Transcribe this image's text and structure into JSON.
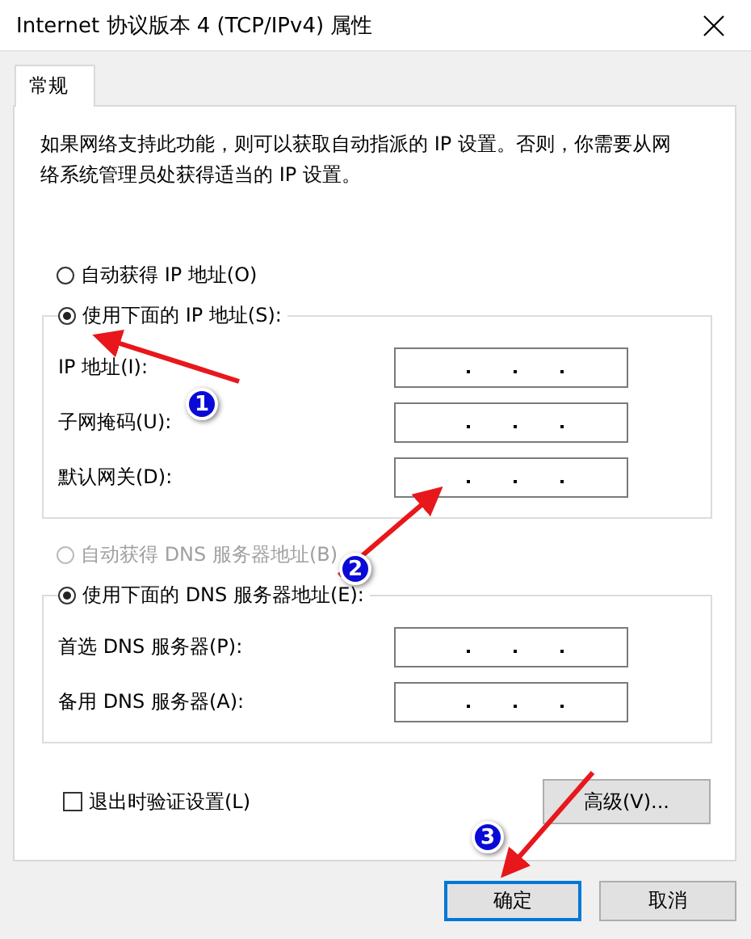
{
  "window": {
    "title": "Internet 协议版本 4 (TCP/IPv4) 属性"
  },
  "tabs": [
    {
      "label": "常规",
      "selected": true
    }
  ],
  "description": "如果网络支持此功能，则可以获取自动指派的 IP 设置。否则，你需要从网络系统管理员处获得适当的 IP 设置。",
  "ip_section": {
    "auto_option": {
      "label": "自动获得 IP 地址(O)",
      "selected": false,
      "disabled": false
    },
    "manual_option": {
      "label": "使用下面的 IP 地址(S):",
      "selected": true,
      "disabled": false
    },
    "fields": [
      {
        "label": "IP 地址(I):"
      },
      {
        "label": "子网掩码(U):"
      },
      {
        "label": "默认网关(D):"
      }
    ]
  },
  "dns_section": {
    "auto_option": {
      "label": "自动获得 DNS 服务器地址(B)",
      "selected": false,
      "disabled": true
    },
    "manual_option": {
      "label": "使用下面的 DNS 服务器地址(E):",
      "selected": true,
      "disabled": false
    },
    "fields": [
      {
        "label": "首选 DNS 服务器(P):"
      },
      {
        "label": "备用 DNS 服务器(A):"
      }
    ]
  },
  "validate_checkbox": {
    "label": "退出时验证设置(L)",
    "checked": false
  },
  "advanced_button": "高级(V)...",
  "buttons": [
    {
      "label": "确定",
      "focused": true
    },
    {
      "label": "取消",
      "focused": false
    }
  ],
  "annotations": [
    {
      "label": "1"
    },
    {
      "label": "2"
    },
    {
      "label": "3"
    }
  ]
}
